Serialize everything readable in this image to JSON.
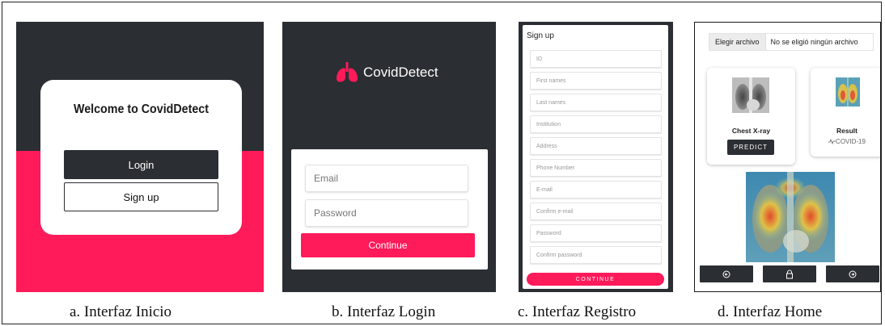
{
  "interfaz_inicio": {
    "title": "Welcome to CovidDetect",
    "login_label": "Login",
    "signup_label": "Sign up",
    "caption": "a. Interfaz Inicio"
  },
  "interfaz_login": {
    "brand": "CovidDetect",
    "email_placeholder": "Email",
    "password_placeholder": "Password",
    "continue_label": "Continue",
    "caption": "b. Interfaz Login"
  },
  "interfaz_registro": {
    "heading": "Sign up",
    "fields": [
      "ID",
      "First names",
      "Last names",
      "Institution",
      "Address",
      "Phone Number",
      "E-mail",
      "Confirm e-mail",
      "Password",
      "Confirm password"
    ],
    "continue_label": "CONTINUE",
    "caption": "c. Interfaz Registro"
  },
  "interfaz_home": {
    "file_button": "Elegir archivo",
    "file_status": "No se eligió ningún archivo",
    "xray_title": "Chest X-ray",
    "predict_label": "PREDICT",
    "result_title": "Result",
    "result_value": "COVID-19",
    "nav_icons": [
      "arrow-left-circle-icon",
      "lock-icon",
      "arrow-right-circle-icon"
    ],
    "caption": "d. Interfaz Home"
  },
  "colors": {
    "dark": "#2b2e33",
    "accent": "#ff1a5a"
  }
}
